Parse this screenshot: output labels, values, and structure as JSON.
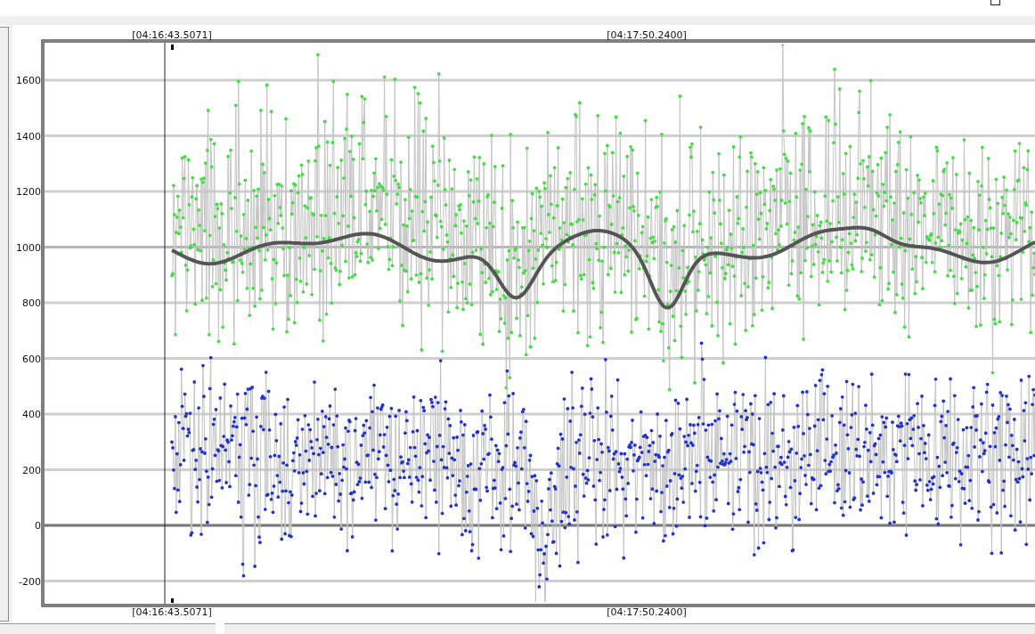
{
  "chart": {
    "time_labels_top": [
      "[04:16:43.5071]",
      "[04:17:50.2400]"
    ],
    "time_labels_bottom": [
      "[04:16:43.5071]",
      "[04:17:50.2400]"
    ],
    "y_tick_labels": [
      "1600",
      "1400",
      "1200",
      "1000",
      "800",
      "600",
      "400",
      "200",
      "0",
      "-200"
    ],
    "series": [
      {
        "color": "#44dd44"
      },
      {
        "color": "#2233cc"
      }
    ]
  }
}
